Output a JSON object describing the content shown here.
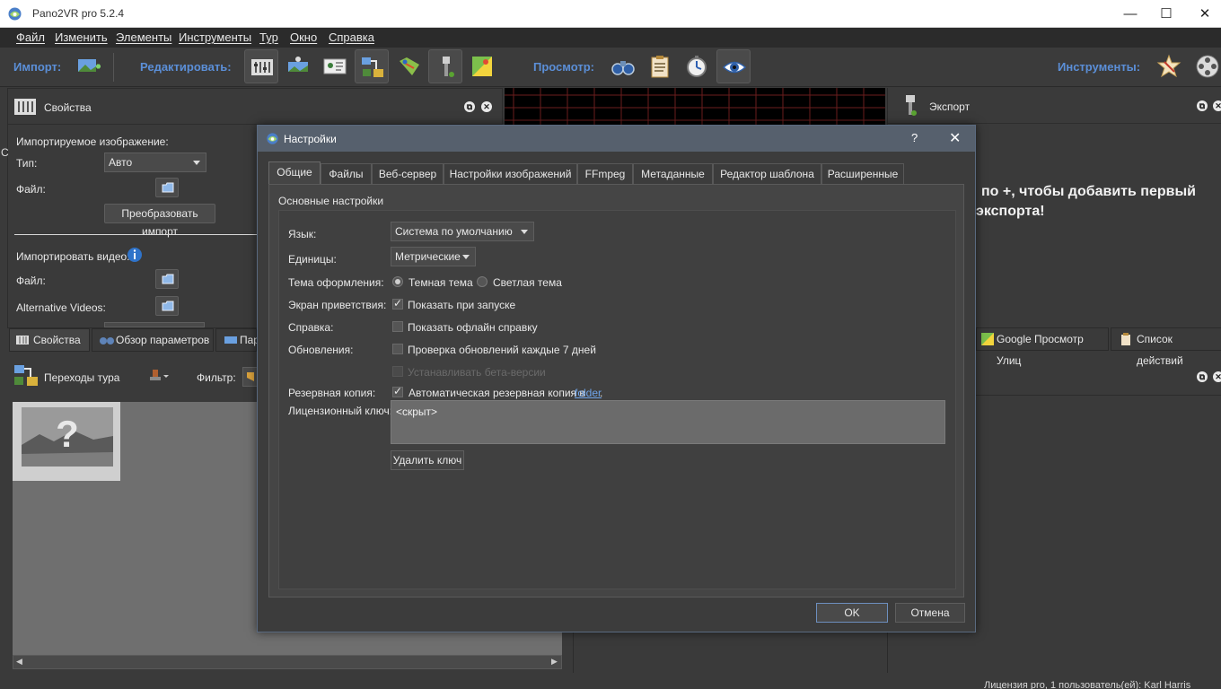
{
  "window": {
    "title": "Pano2VR pro 5.2.4"
  },
  "menu": [
    "Файл",
    "Изменить",
    "Элементы",
    "Инструменты",
    "Тур",
    "Окно",
    "Справка"
  ],
  "toolbar": {
    "import_label": "Импорт:",
    "edit_label": "Редактировать:",
    "view_label": "Просмотр:",
    "tools_label": "Инструменты:"
  },
  "properties": {
    "title": "Свойства",
    "imported_image": "Импортируемое изображение:",
    "type_label": "Тип:",
    "type_value": "Авто",
    "file_label": "Файл:",
    "convert_button": "Преобразовать импорт",
    "import_video": "Импортировать видео:",
    "video_file_label": "Файл:",
    "alt_videos_label": "Alternative Videos:"
  },
  "bottom_tabs": {
    "properties": "Свойства",
    "params_overview": "Обзор параметров",
    "partial": "Пар"
  },
  "tour": {
    "title": "Переходы тура",
    "filter_label": "Фильтр:"
  },
  "export": {
    "title": "Экспорт",
    "hint_line1": "по +, чтобы добавить первый",
    "hint_line2": "экспорта!"
  },
  "right_tabs": {
    "google": "Google Просмотр Улиц",
    "actions": "Список действий"
  },
  "status": {
    "license": "Лицензия pro, 1 пользователь(ей): Karl Harris"
  },
  "dialog": {
    "title": "Настройки",
    "help": "?",
    "tabs": [
      "Общие",
      "Файлы",
      "Веб-сервер",
      "Настройки изображений",
      "FFmpeg",
      "Метаданные",
      "Редактор шаблона",
      "Расширенные"
    ],
    "group_title": "Основные настройки",
    "language_label": "Язык:",
    "language_value": "Система по умолчанию",
    "units_label": "Единицы:",
    "units_value": "Метрические",
    "theme_label": "Тема оформления:",
    "theme_dark": "Темная тема",
    "theme_light": "Светлая тема",
    "welcome_label": "Экран приветствия:",
    "welcome_check": "Показать при запуске",
    "help_label": "Справка:",
    "help_check": "Показать офлайн справку",
    "updates_label": "Обновления:",
    "updates_check": "Проверка обновлений каждые 7 дней",
    "beta_check": "Устанавливать бета-версии",
    "backup_label": "Резервная копия:",
    "backup_check": "Автоматическая резервная копия в",
    "backup_link": "folder",
    "backup_dot": ".",
    "license_label": "Лицензионный ключ:",
    "license_value": "<скрыт>",
    "delete_key": "Удалить ключ",
    "ok": "OK",
    "cancel": "Отмена"
  }
}
